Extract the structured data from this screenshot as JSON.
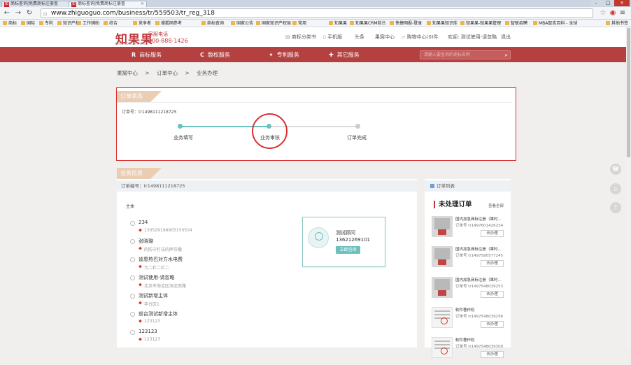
{
  "browser": {
    "tabs": [
      {
        "label": "商标查询|免费商标注册查"
      },
      {
        "label": "商标查询|免费商标注册查"
      }
    ],
    "url": "www.zhiguoguo.com/business/tr/559503/tr_reg_318",
    "bookmarks": [
      "商标",
      "国际",
      "专利",
      "知识产权",
      "工作辅助",
      "综合",
      "竞争者",
      "搜狐网参考",
      "商标查询",
      "国家公告",
      "国家知识产权局",
      "常用",
      "知果果",
      "知果果CRM前台",
      "快捷网报-登录",
      "知果果知识库",
      "知果果-知果果管理",
      "智联招聘",
      "MBA智库百科 - 全球",
      "其他书签"
    ]
  },
  "site": {
    "logo": "知果果",
    "logo_sub": "ZHIGUOGUO.COM",
    "hotline_label": "客服电话",
    "hotline": "400-888-1426",
    "top_links": [
      "商标分类书",
      "手机版",
      "头条",
      "果窝中心",
      "购物中心(0)件",
      "欢迎: 测试使用-请忽略",
      "退出"
    ],
    "nav": [
      {
        "icon": "R",
        "label": "商标服务"
      },
      {
        "icon": "C",
        "label": "版权服务"
      },
      {
        "icon": "✦",
        "label": "专利服务"
      },
      {
        "icon": "✚",
        "label": "其它服务"
      }
    ],
    "search_placeholder": "请输入要查询的商标名称"
  },
  "breadcrumb": [
    "果窝中心",
    ">",
    "订单中心",
    ">",
    "业务办理"
  ],
  "order_status": {
    "section_title": "订单状态",
    "order_number": "订单号：tr1498111218725",
    "steps": [
      "业务填写",
      "业务审核",
      "订单完成"
    ],
    "current_step": 2
  },
  "business_info": {
    "section_title": "业务信息",
    "order_number": "订单编号：tr1498111218725",
    "subject_label": "主体",
    "subjects": [
      {
        "name": "234",
        "address": "130529198905150504"
      },
      {
        "name": "张晓璐",
        "address": "的防守打法的萨芬撒"
      },
      {
        "name": "迪恩热巴对方水电费",
        "address": "为二栏二栏二"
      },
      {
        "name": "测试使用-请忽略",
        "address": "北京市海淀区海淀南路"
      },
      {
        "name": "测试新增主体",
        "address": "丰台区1"
      },
      {
        "name": "前台测试新增主体",
        "address": "123123"
      },
      {
        "name": "123123",
        "address": "123123"
      }
    ],
    "consultant": {
      "name": "测试顾问",
      "phone": "13621269101",
      "button": "立即咨询"
    }
  },
  "order_list": {
    "header": "订单列表",
    "title": "未处理订单",
    "view_all": "查看全部",
    "items": [
      {
        "title": "国内加急商标注册（果时...",
        "number": "订单号 tr1497601426234",
        "button": "去办理"
      },
      {
        "title": "国内加急商标注册（果时...",
        "number": "订单号 tr1497580577245",
        "button": "去办理"
      },
      {
        "title": "国内加急商标注册（果时...",
        "number": "订单号 tr1497548039253",
        "button": "去办理"
      },
      {
        "title": "软件著作权",
        "number": "订单号 tr1497548039296",
        "button": "去办理"
      },
      {
        "title": "软件著作权",
        "number": "订单号 tr1497548039300",
        "button": "去办理"
      }
    ]
  },
  "colors": {
    "brand_red": "#b44040",
    "accent_teal": "#6cc1bf",
    "highlight_red": "#d9302f",
    "section_tab": "#ebcdb4"
  }
}
